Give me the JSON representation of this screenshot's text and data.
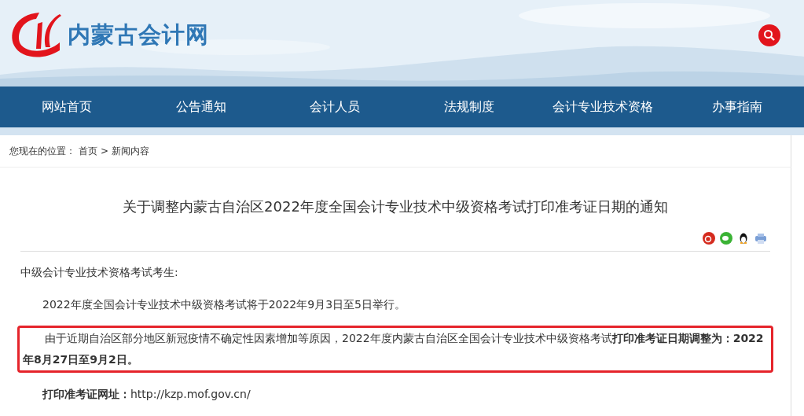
{
  "site": {
    "name": "内蒙古会计网"
  },
  "nav": [
    {
      "label": "网站首页"
    },
    {
      "label": "公告通知"
    },
    {
      "label": "会计人员"
    },
    {
      "label": "法规制度"
    },
    {
      "label": "会计专业技术资格"
    },
    {
      "label": "办事指南"
    }
  ],
  "breadcrumb": {
    "prefix": "您现在的位置：",
    "items": [
      {
        "label": "首页"
      },
      {
        "label": "新闻内容"
      }
    ],
    "separator": ">"
  },
  "article": {
    "title": "关于调整内蒙古自治区2022年度全国会计专业技术中级资格考试打印准考证日期的通知",
    "paragraphs": [
      {
        "kind": "plain",
        "text": "中级会计专业技术资格考试考生:"
      },
      {
        "kind": "indent",
        "text": "2022年度全国会计专业技术中级资格考试将于2022年9月3日至5日举行。"
      },
      {
        "kind": "highlight",
        "text": "由于近期自治区部分地区新冠疫情不确定性因素增加等原因，2022年度内蒙古自治区全国会计专业技术中级资格考试**打印准考证日期调整为：2022年8月27日至9月2日。**"
      },
      {
        "kind": "link",
        "label": "打印准考证网址：",
        "url": "http://kzp.mof.gov.cn/"
      }
    ]
  }
}
